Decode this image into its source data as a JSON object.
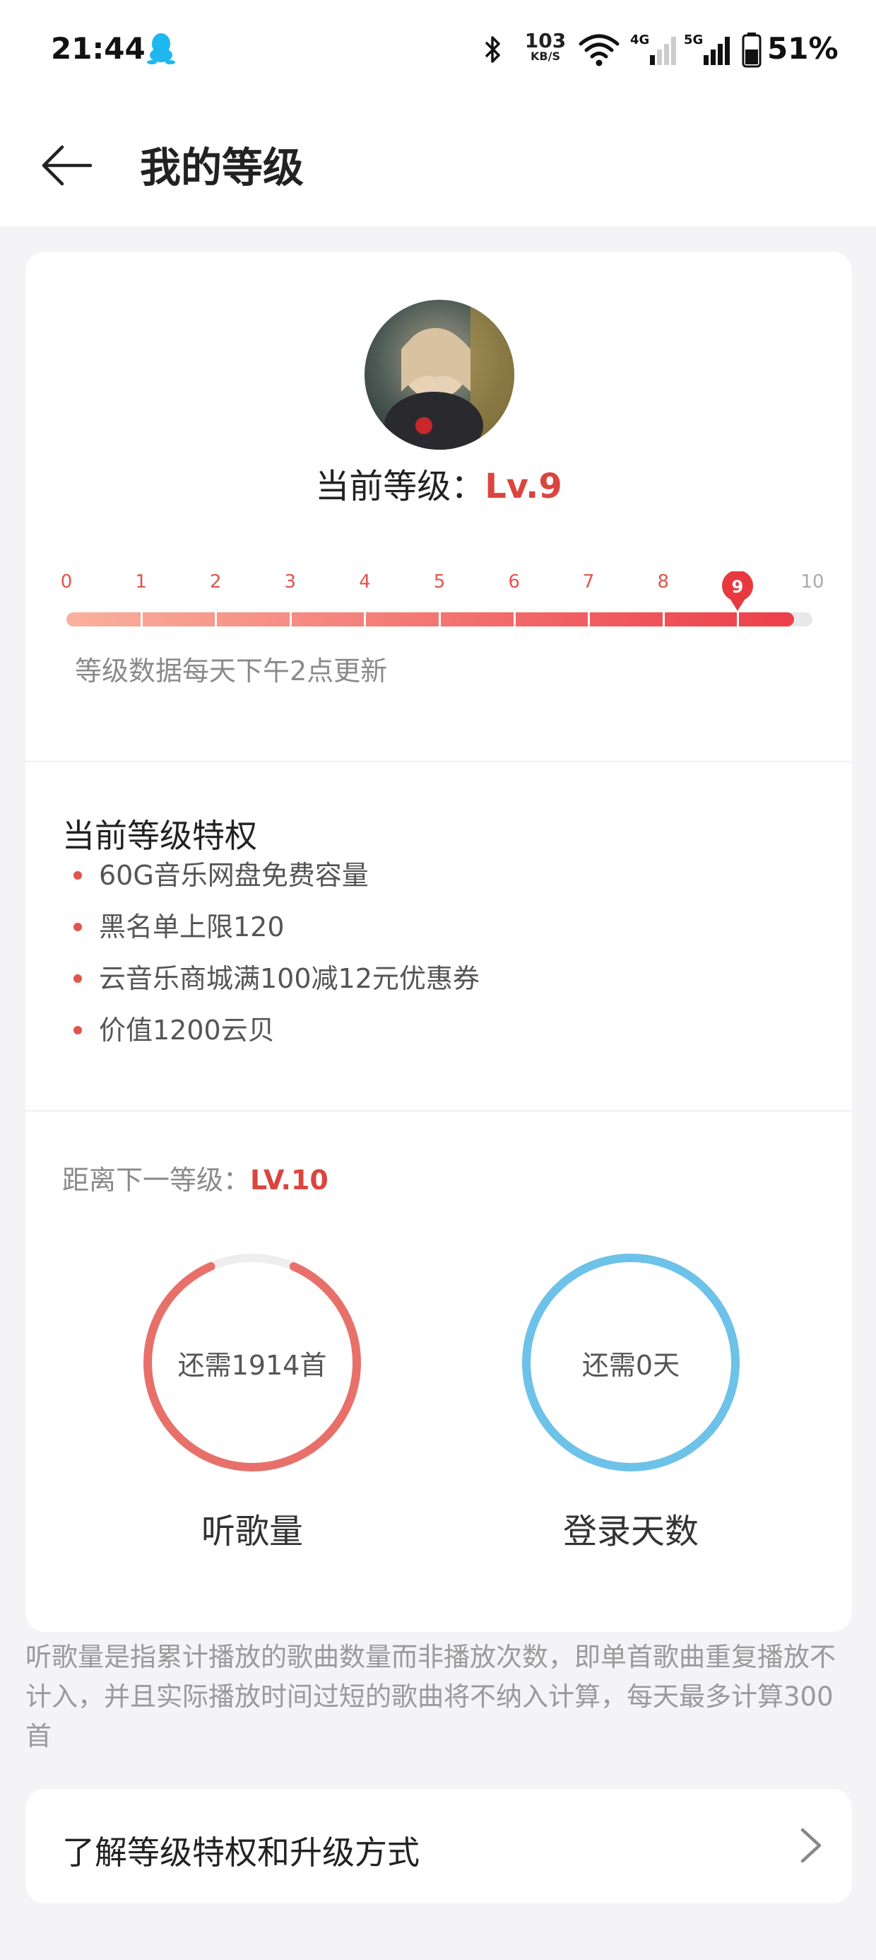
{
  "status_bar": {
    "time": "21:44",
    "net_speed_value": "103",
    "net_speed_unit": "KB/S",
    "signal1_label": "4G",
    "signal2_label": "5G",
    "battery": "51%",
    "icons": [
      "qq-icon",
      "bluetooth-icon",
      "wifi-icon",
      "signal-icon",
      "battery-icon"
    ]
  },
  "header": {
    "title": "我的等级",
    "back_icon": "back-arrow-icon"
  },
  "level": {
    "prefix": "当前等级：",
    "value": "Lv.9",
    "current": 9,
    "ticks": [
      "0",
      "1",
      "2",
      "3",
      "4",
      "5",
      "6",
      "7",
      "8",
      "9",
      "10"
    ],
    "progress_fraction": 0.975,
    "update_note": "等级数据每天下午2点更新"
  },
  "privileges": {
    "title": "当前等级特权",
    "items": [
      "60G音乐网盘免费容量",
      "黑名单上限120",
      "云音乐商城满100减12元优惠券",
      "价值1200云贝"
    ]
  },
  "next_level": {
    "prefix": "距离下一等级：",
    "value": "LV.10",
    "listen": {
      "text": "还需1914首",
      "label": "听歌量",
      "progress_fraction": 0.87,
      "color": "#e8706a"
    },
    "login": {
      "text": "还需0天",
      "label": "登录天数",
      "progress_fraction": 1.0,
      "color": "#6cc2e8"
    }
  },
  "footnote": "听歌量是指累计播放的歌曲数量而非播放次数，即单首歌曲重复播放不计入，并且实际播放时间过短的歌曲将不纳入计算，每天最多计算300首",
  "learn_more": {
    "label": "了解等级特权和升级方式",
    "icon": "chevron-right-icon"
  },
  "colors": {
    "accent": "#d9463f",
    "track": "#e8e8e8",
    "background": "#f4f4f6"
  }
}
